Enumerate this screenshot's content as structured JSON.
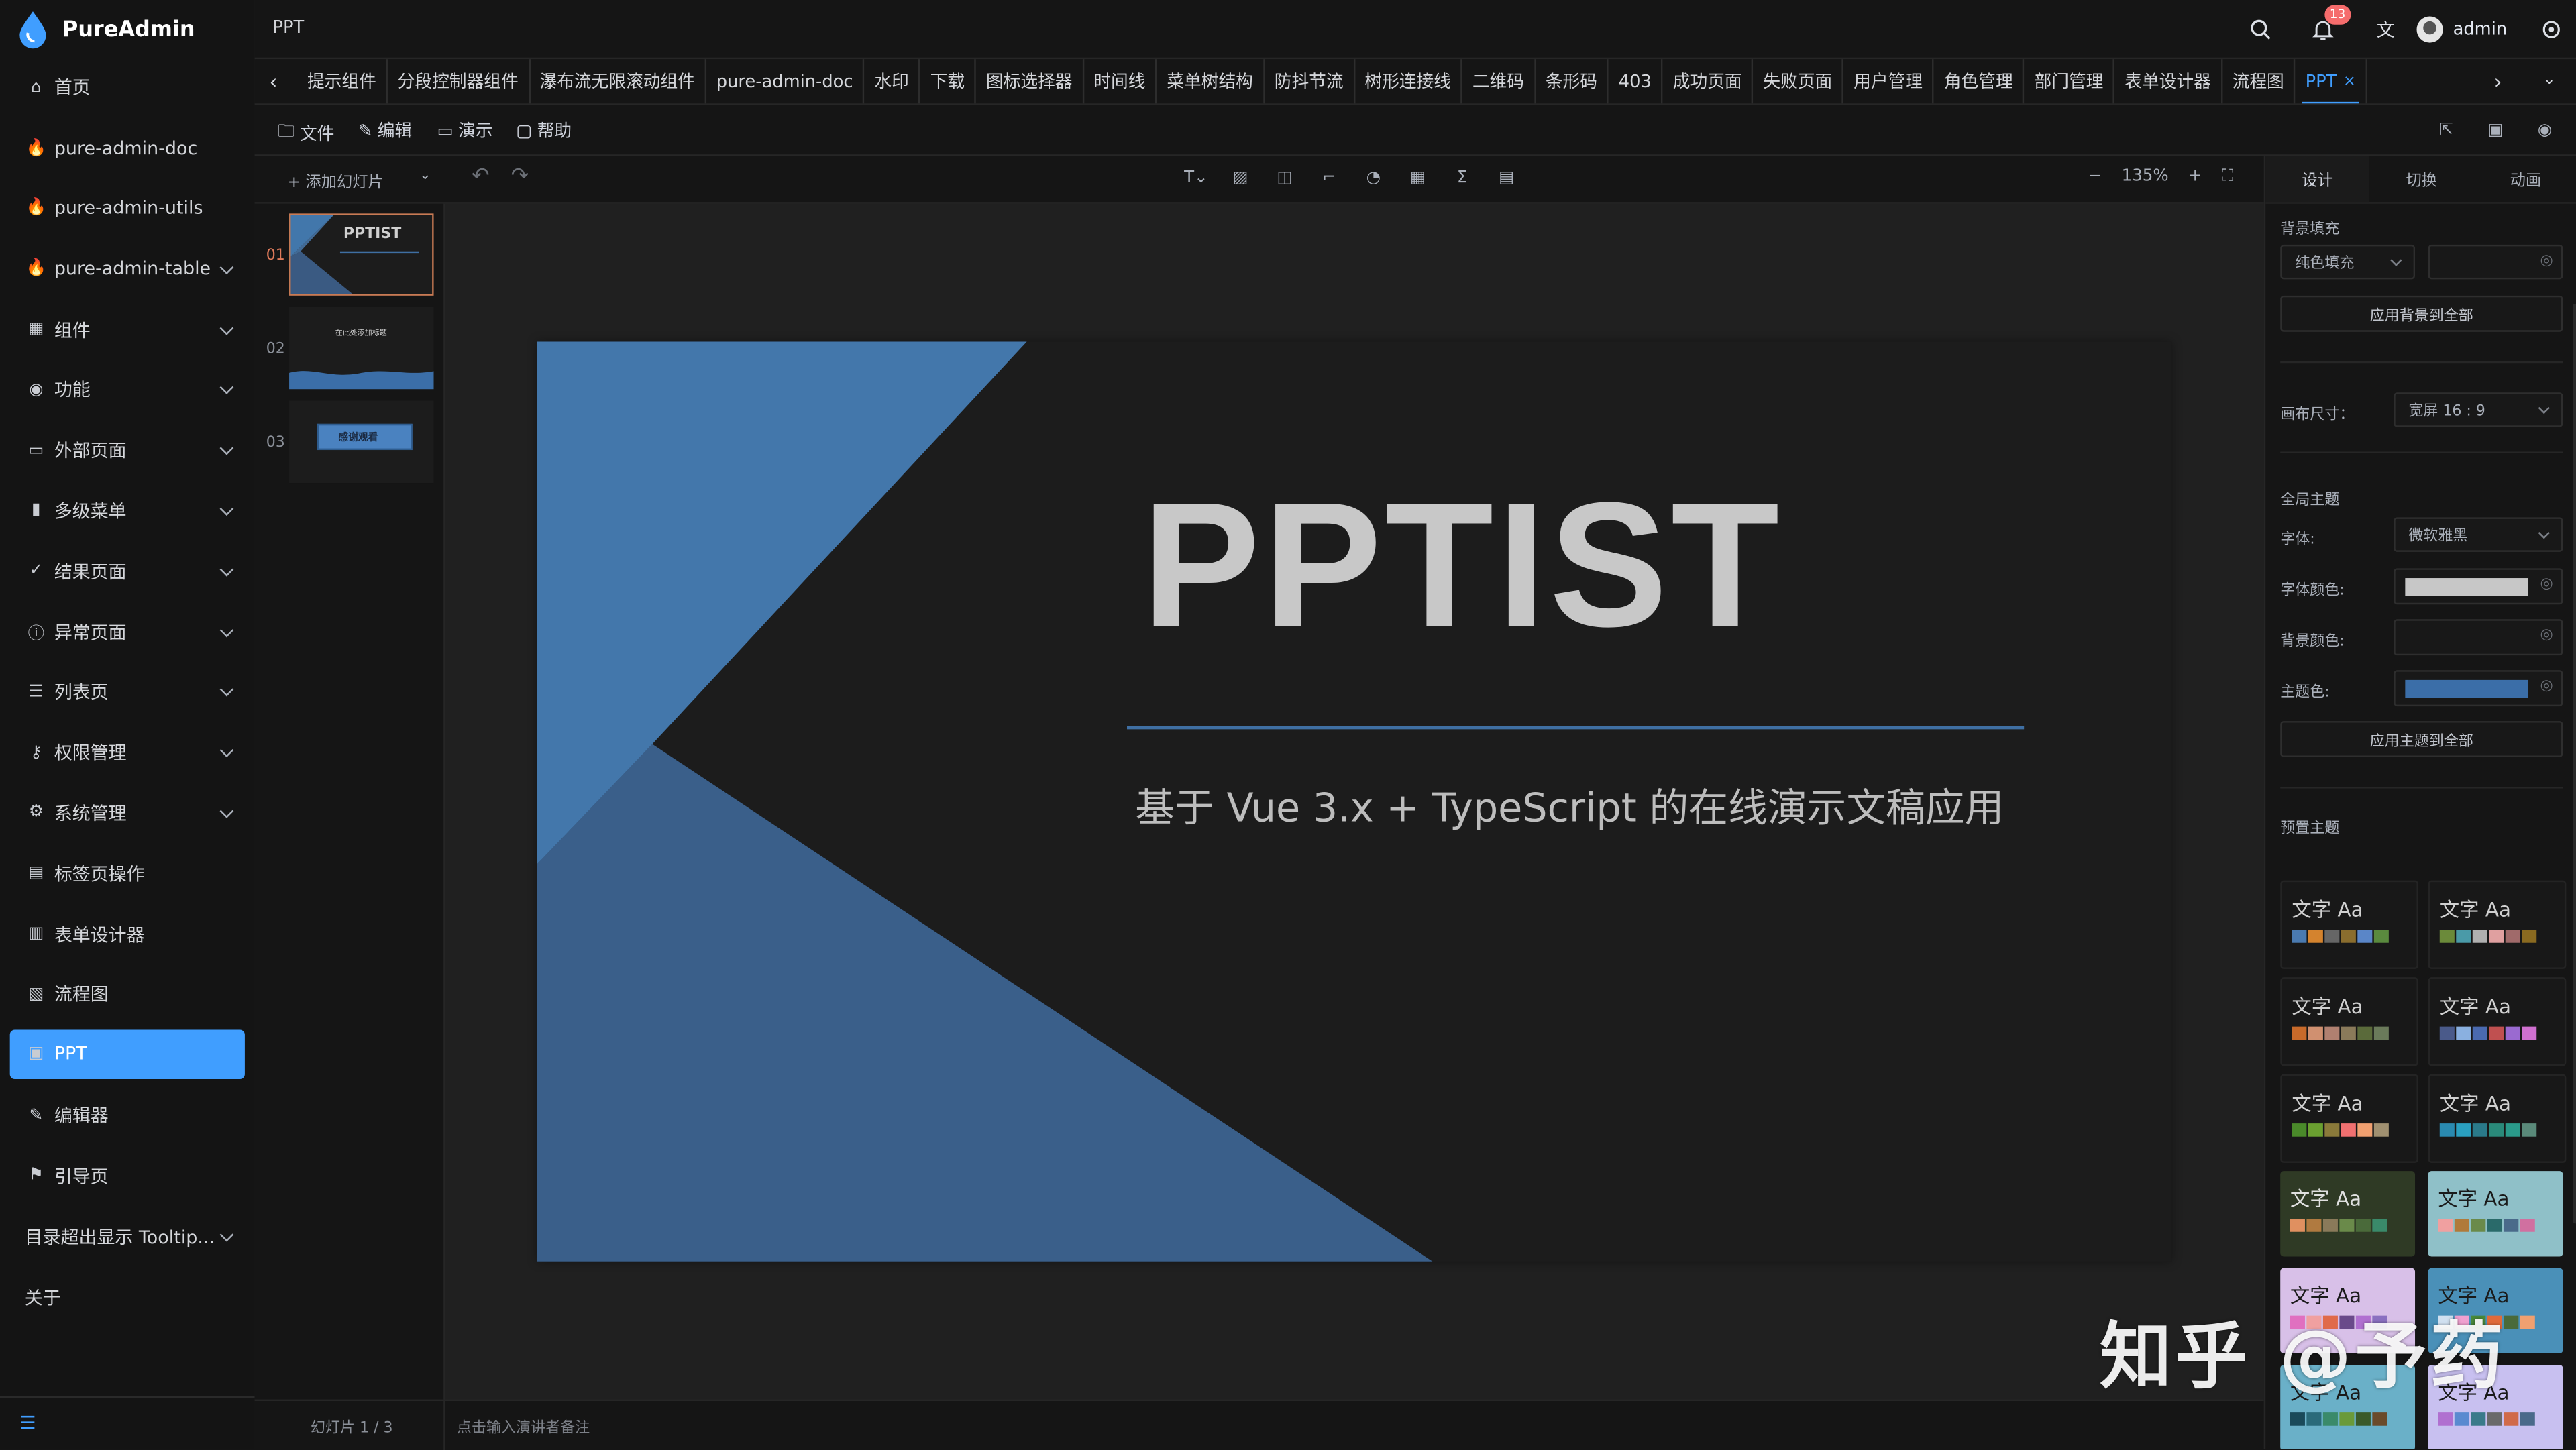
{
  "app": {
    "name": "PureAdmin",
    "page_title": "PPT"
  },
  "sidebar": {
    "items": [
      {
        "label": "首页",
        "icon": "home-icon",
        "submenu": false
      },
      {
        "label": "pure-admin-doc",
        "icon": "fire-icon",
        "submenu": false
      },
      {
        "label": "pure-admin-utils",
        "icon": "fire-icon",
        "submenu": false
      },
      {
        "label": "pure-admin-table",
        "icon": "fire-icon",
        "submenu": true
      },
      {
        "label": "组件",
        "icon": "grid-icon",
        "submenu": true
      },
      {
        "label": "功能",
        "icon": "function-icon",
        "submenu": true
      },
      {
        "label": "外部页面",
        "icon": "monitor-icon",
        "submenu": true
      },
      {
        "label": "多级菜单",
        "icon": "bar-chart-icon",
        "submenu": true
      },
      {
        "label": "结果页面",
        "icon": "check-circle-icon",
        "submenu": true
      },
      {
        "label": "异常页面",
        "icon": "info-circle-icon",
        "submenu": true
      },
      {
        "label": "列表页",
        "icon": "list-icon",
        "submenu": true
      },
      {
        "label": "权限管理",
        "icon": "key-icon",
        "submenu": true
      },
      {
        "label": "系统管理",
        "icon": "settings-icon",
        "submenu": true
      },
      {
        "label": "标签页操作",
        "icon": "tabs-icon",
        "submenu": false
      },
      {
        "label": "表单设计器",
        "icon": "form-icon",
        "submenu": false
      },
      {
        "label": "流程图",
        "icon": "flowchart-icon",
        "submenu": false
      },
      {
        "label": "PPT",
        "icon": "ppt-icon",
        "submenu": false,
        "active": true
      },
      {
        "label": "编辑器",
        "icon": "edit-icon",
        "submenu": false
      },
      {
        "label": "引导页",
        "icon": "guide-icon",
        "submenu": false
      },
      {
        "label": "目录超出显示 Tooltip...",
        "icon": "",
        "submenu": true
      },
      {
        "label": "关于",
        "icon": "",
        "submenu": false
      }
    ]
  },
  "header": {
    "notification_count": "13",
    "username": "admin"
  },
  "tabs": [
    {
      "label": "提示组件"
    },
    {
      "label": "分段控制器组件"
    },
    {
      "label": "瀑布流无限滚动组件"
    },
    {
      "label": "pure-admin-doc"
    },
    {
      "label": "水印"
    },
    {
      "label": "下载"
    },
    {
      "label": "图标选择器"
    },
    {
      "label": "时间线"
    },
    {
      "label": "菜单树结构"
    },
    {
      "label": "防抖节流"
    },
    {
      "label": "树形连接线"
    },
    {
      "label": "二维码"
    },
    {
      "label": "条形码"
    },
    {
      "label": "403"
    },
    {
      "label": "成功页面"
    },
    {
      "label": "失败页面"
    },
    {
      "label": "用户管理"
    },
    {
      "label": "角色管理"
    },
    {
      "label": "部门管理"
    },
    {
      "label": "表单设计器"
    },
    {
      "label": "流程图"
    },
    {
      "label": "PPT",
      "active": true
    }
  ],
  "editor": {
    "menubar": {
      "file": "文件",
      "edit": "编辑",
      "present": "演示",
      "help": "帮助"
    },
    "toolbar": {
      "add_slide": "+ 添加幻灯片",
      "zoom": "135%"
    },
    "thumbnails": [
      {
        "num": "01",
        "title": "PPTIST",
        "active": true
      },
      {
        "num": "02",
        "title": "在此处添加标题"
      },
      {
        "num": "03",
        "title": "感谢观看"
      }
    ],
    "slide": {
      "title": "PPTIST",
      "subtitle": "基于 Vue 3.x + TypeScript 的在线演示文稿应用",
      "accent_color": "#3f6fa3"
    },
    "status": {
      "slide_counter": "幻灯片 1 / 3",
      "notes_placeholder": "点击输入演讲者备注"
    }
  },
  "panel": {
    "tabs": [
      "设计",
      "切换",
      "动画"
    ],
    "background_fill_label": "背景填充",
    "fill_type": "纯色填充",
    "apply_bg_all": "应用背景到全部",
    "canvas_size_label": "画布尺寸：",
    "canvas_size_value": "宽屏 16 : 9",
    "global_theme_label": "全局主题",
    "font_label": "字体:",
    "font_value": "微软雅黑",
    "font_color_label": "字体颜色:",
    "font_color": "#c7c7c7",
    "bg_color_label": "背景颜色:",
    "theme_color_label": "主题色:",
    "theme_color": "#3b6ea8",
    "apply_theme_all": "应用主题到全部",
    "preset_themes_label": "预置主题",
    "theme_sample_text": "文字 Aa",
    "preset_themes": [
      {
        "bg": "#181818",
        "fg": "#d0d0d0",
        "colors": [
          "#4a7ab0",
          "#d4832e",
          "#666666",
          "#8a6d2e",
          "#5a86c8",
          "#5a8a3e"
        ]
      },
      {
        "bg": "#181818",
        "fg": "#d0d0d0",
        "colors": [
          "#6b8a3a",
          "#4a9aa8",
          "#b0b0b0",
          "#e0a0a0",
          "#a06a6a",
          "#8a6a20"
        ]
      },
      {
        "bg": "#181818",
        "fg": "#d0d0d0",
        "colors": [
          "#c86a2a",
          "#d09070",
          "#b08070",
          "#8a7a5a",
          "#5a6a3a",
          "#6a7a5a"
        ]
      },
      {
        "bg": "#181818",
        "fg": "#d0d0d0",
        "colors": [
          "#4a5a8a",
          "#8ab0e0",
          "#4a6ab0",
          "#c05050",
          "#9a6ad0",
          "#d070d0"
        ]
      },
      {
        "bg": "#181818",
        "fg": "#d0d0d0",
        "colors": [
          "#4a8a2a",
          "#6aa030",
          "#8a7a3a",
          "#f07070",
          "#f0a070",
          "#a09070"
        ]
      },
      {
        "bg": "#181818",
        "fg": "#d0d0d0",
        "colors": [
          "#2a8ab0",
          "#2aa0c0",
          "#2a7a8a",
          "#2a8a7a",
          "#2a9a8a",
          "#5a8a7a"
        ]
      },
      {
        "bg": "#2f3a25",
        "fg": "#e0e0e0",
        "colors": [
          "#e09060",
          "#b07a40",
          "#8a7a5a",
          "#6a8a4a",
          "#4a6a3a",
          "#3a8a6a"
        ]
      },
      {
        "bg": "#8fc0c8",
        "fg": "#1a1a1a",
        "colors": [
          "#f0a0a0",
          "#b07a3a",
          "#6a8a4a",
          "#2a6a6a",
          "#4a6a8a",
          "#d070a0"
        ]
      },
      {
        "bg": "#d8c0e8",
        "fg": "#1a1a1a",
        "colors": [
          "#e070c0",
          "#f0a0a0",
          "#e06a4a",
          "#6a4a8a",
          "#b070d0",
          "#8a70c0"
        ]
      },
      {
        "bg": "#4a90b8",
        "fg": "#1a1a1a",
        "colors": [
          "#d0e0f0",
          "#f0a0d0",
          "#4a8a3a",
          "#e06a3a",
          "#4a6a3a",
          "#f0a070"
        ]
      },
      {
        "bg": "#6ab0c8",
        "fg": "#1a1a1a",
        "colors": [
          "#1a4a5a",
          "#2a6a7a",
          "#3a8a6a",
          "#6a9a3a",
          "#3a5a2a",
          "#6a4a2a"
        ]
      },
      {
        "bg": "#c8c0f0",
        "fg": "#1a1a1a",
        "colors": [
          "#b070d0",
          "#5a8ad0",
          "#3a7a8a",
          "#6a6a6a",
          "#d06a4a",
          "#4a6a8a"
        ]
      }
    ]
  },
  "watermark": "知乎 @予药"
}
